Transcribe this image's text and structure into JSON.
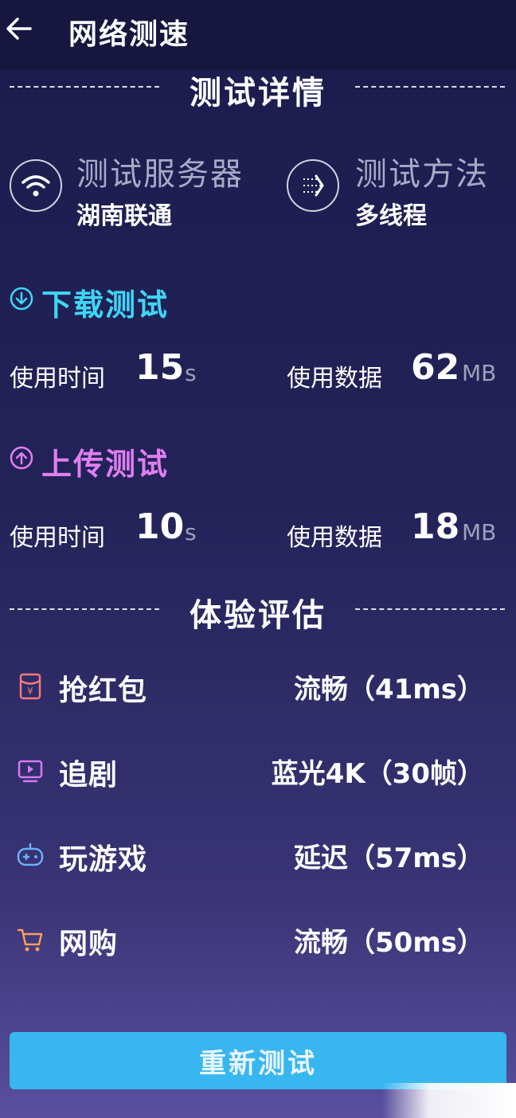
{
  "header": {
    "title": "网络测速"
  },
  "details": {
    "section_title": "测试详情",
    "server": {
      "label": "测试服务器",
      "value": "湖南联通",
      "icon": "wifi-icon"
    },
    "method": {
      "label": "测试方法",
      "value": "多线程",
      "icon": "multi-thread-icon"
    }
  },
  "download": {
    "title": "下载测试",
    "time_label": "使用时间",
    "time_value": "15",
    "time_unit": "s",
    "data_label": "使用数据",
    "data_value": "62",
    "data_unit": "MB"
  },
  "upload": {
    "title": "上传测试",
    "time_label": "使用时间",
    "time_value": "10",
    "time_unit": "s",
    "data_label": "使用数据",
    "data_value": "18",
    "data_unit": "MB"
  },
  "experience": {
    "section_title": "体验评估",
    "items": [
      {
        "label": "抢红包",
        "value": "流畅（41ms）",
        "icon": "red-envelope-icon",
        "color": "#f07a7a"
      },
      {
        "label": "追剧",
        "value": "蓝光4K（30帧）",
        "icon": "tv-icon",
        "color": "#d67af0"
      },
      {
        "label": "玩游戏",
        "value": "延迟（57ms）",
        "icon": "gamepad-icon",
        "color": "#6ab0f5"
      },
      {
        "label": "网购",
        "value": "流畅（50ms）",
        "icon": "cart-icon",
        "color": "#f5a05a"
      }
    ]
  },
  "actions": {
    "retest_label": "重新测试"
  },
  "colors": {
    "download": "#3ed6f5",
    "upload": "#e07ef0",
    "button": "#38b6f0"
  }
}
